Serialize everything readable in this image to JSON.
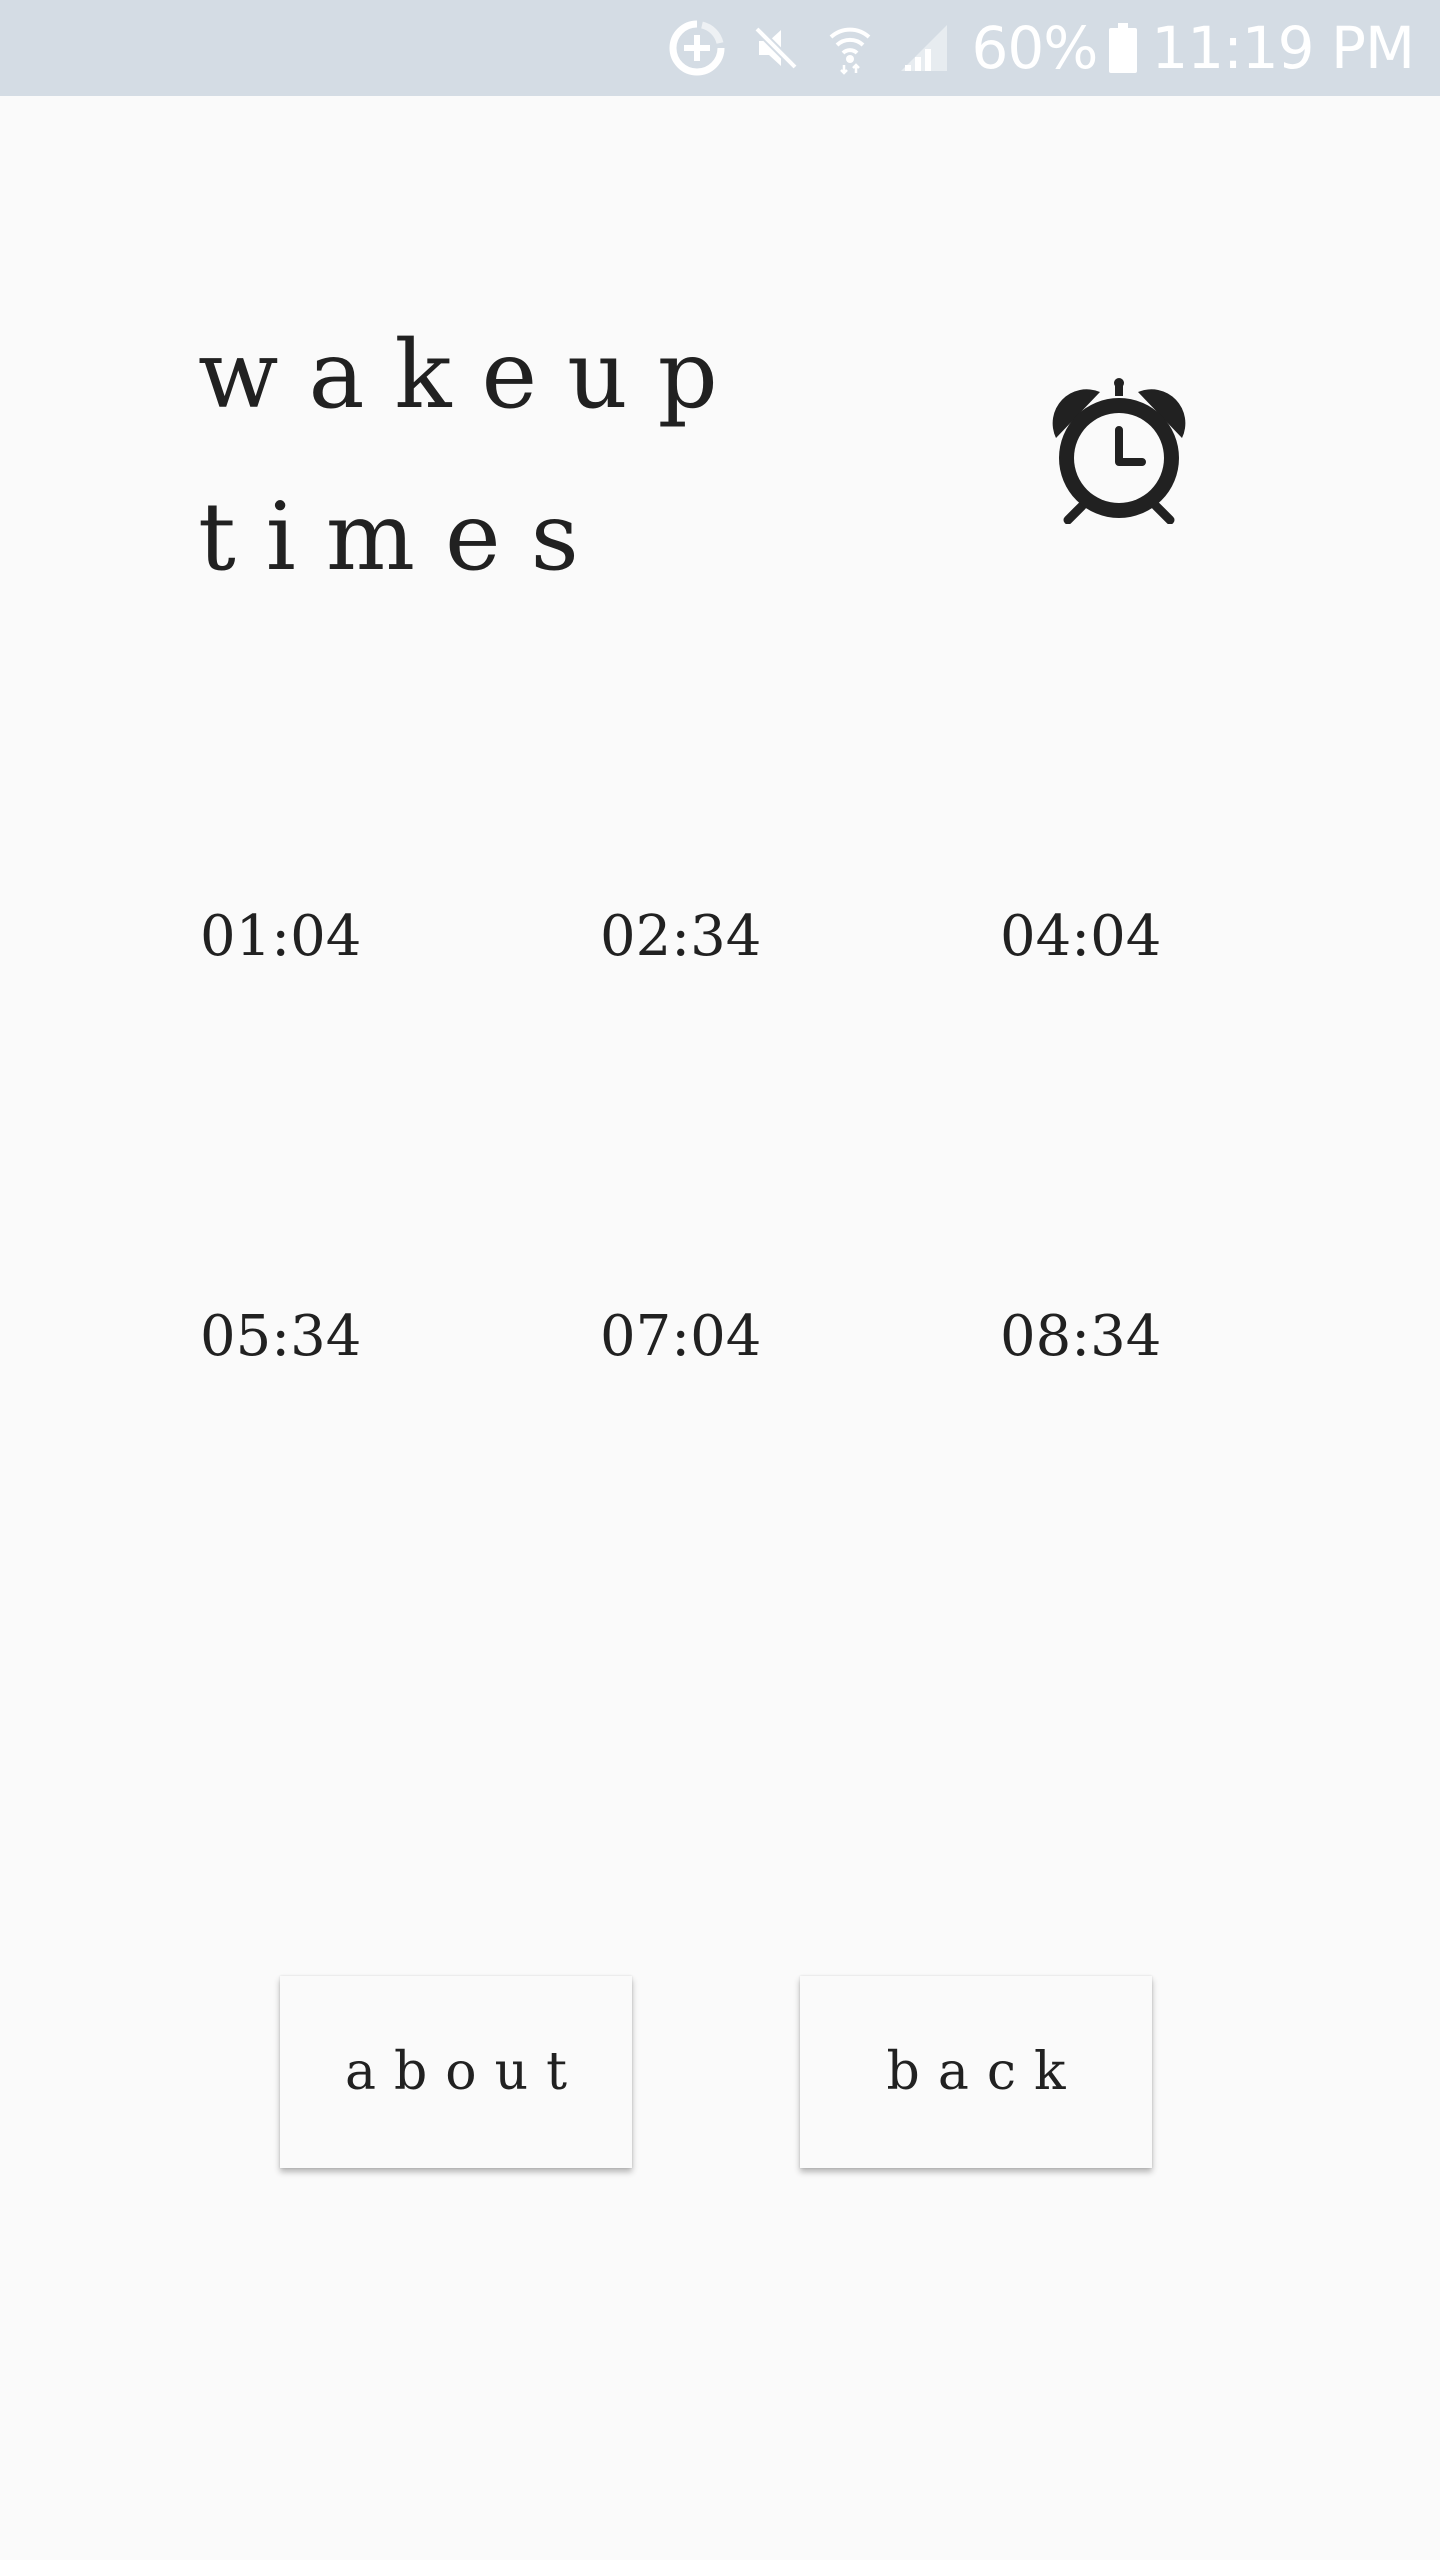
{
  "status_bar": {
    "battery_percent": "60%",
    "time": "11:19 PM",
    "icons": [
      "data-saver-icon",
      "mute-icon",
      "wifi-icon",
      "signal-icon",
      "battery-icon"
    ]
  },
  "header": {
    "title_line1": "wakeup",
    "title_line2": "times",
    "icon": "alarm-clock-icon"
  },
  "times": [
    "01:04",
    "02:34",
    "04:04",
    "05:34",
    "07:04",
    "08:34"
  ],
  "buttons": {
    "about": "about",
    "back": "back"
  }
}
